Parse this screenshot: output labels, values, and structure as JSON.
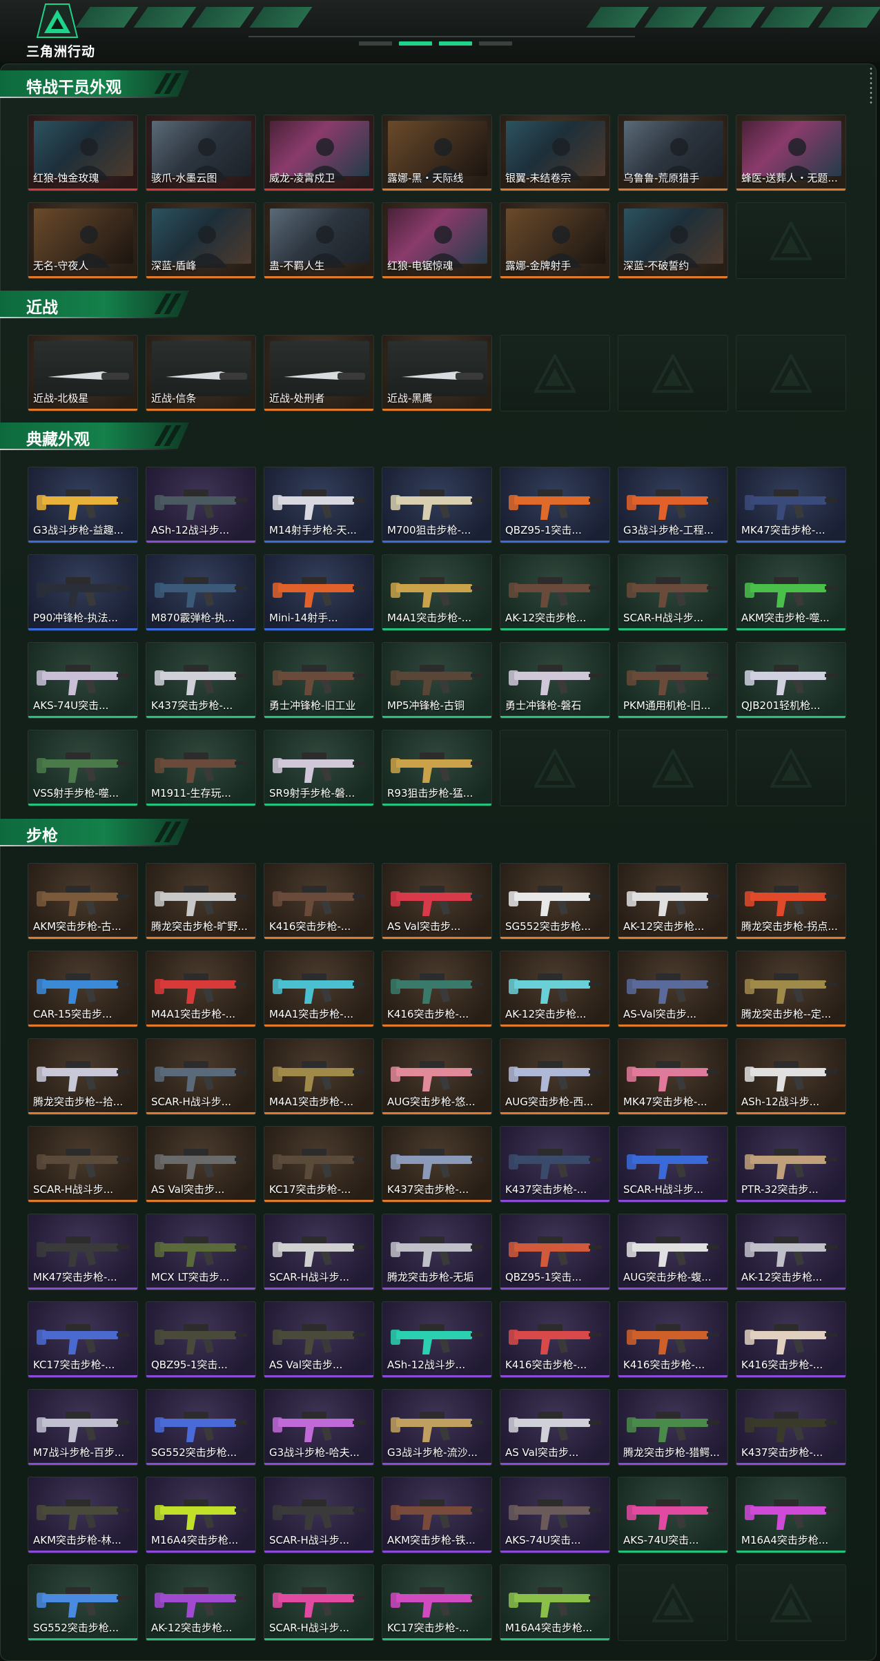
{
  "app": {
    "title": "三角洲行动"
  },
  "colors": {
    "accent": "#1ed48a",
    "section": "#14804a"
  },
  "sections": [
    {
      "title": "特战干员外观",
      "items": [
        {
          "label": "红狼-蚀金玫瑰",
          "tier": "red",
          "kind": "operator"
        },
        {
          "label": "骇爪-水墨云图",
          "tier": "red",
          "kind": "operator"
        },
        {
          "label": "威龙-凌霄戍卫",
          "tier": "red",
          "kind": "operator"
        },
        {
          "label": "露娜-黑・天际线",
          "tier": "orange",
          "kind": "operator"
        },
        {
          "label": "银翼-未结卷宗",
          "tier": "orange",
          "kind": "operator"
        },
        {
          "label": "乌鲁鲁-荒原猎手",
          "tier": "orange",
          "kind": "operator"
        },
        {
          "label": "蜂医-送葬人・无题...",
          "tier": "orange",
          "kind": "operator"
        },
        {
          "label": "无名-守夜人",
          "tier": "orange",
          "kind": "operator"
        },
        {
          "label": "深蓝-盾峰",
          "tier": "orange",
          "kind": "operator"
        },
        {
          "label": "蛊-不羁人生",
          "tier": "orange",
          "kind": "operator"
        },
        {
          "label": "红狼-电锯惊魂",
          "tier": "orange",
          "kind": "operator"
        },
        {
          "label": "露娜-金牌射手",
          "tier": "orange",
          "kind": "operator"
        },
        {
          "label": "深蓝-不破誓约",
          "tier": "orange",
          "kind": "operator"
        },
        {
          "label": "",
          "tier": "empty",
          "kind": "empty"
        }
      ]
    },
    {
      "title": "近战",
      "items": [
        {
          "label": "近战-北极星",
          "tier": "orange",
          "kind": "knife"
        },
        {
          "label": "近战-信条",
          "tier": "orange",
          "kind": "knife"
        },
        {
          "label": "近战-处刑者",
          "tier": "orange",
          "kind": "knife"
        },
        {
          "label": "近战-黑鹰",
          "tier": "orange",
          "kind": "knife"
        },
        {
          "label": "",
          "tier": "empty",
          "kind": "empty"
        },
        {
          "label": "",
          "tier": "empty",
          "kind": "empty"
        },
        {
          "label": "",
          "tier": "empty",
          "kind": "empty"
        }
      ]
    },
    {
      "title": "典藏外观",
      "items": [
        {
          "label": "G3战斗步枪-益趣...",
          "tier": "blue",
          "kind": "gun",
          "color": "#e8b23a"
        },
        {
          "label": "ASh-12战斗步...",
          "tier": "purple",
          "kind": "gun",
          "color": "#4a5a60"
        },
        {
          "label": "M14射手步枪-天...",
          "tier": "blue",
          "kind": "gun",
          "color": "#d8d8e0"
        },
        {
          "label": "M700狙击步枪-...",
          "tier": "blue",
          "kind": "gun",
          "color": "#d8cfb0"
        },
        {
          "label": "QBZ95-1突击...",
          "tier": "blue",
          "kind": "gun",
          "color": "#e06a2a"
        },
        {
          "label": "G3战斗步枪-工程...",
          "tier": "blue",
          "kind": "gun",
          "color": "#e0622a"
        },
        {
          "label": "MK47突击步枪-...",
          "tier": "blue",
          "kind": "gun",
          "color": "#3a4a7a"
        },
        {
          "label": "P90冲锋枪-执法...",
          "tier": "blue",
          "kind": "gun",
          "color": "#2a2e38"
        },
        {
          "label": "M870霰弹枪-执...",
          "tier": "blue",
          "kind": "gun",
          "color": "#3b5a7a"
        },
        {
          "label": "Mini-14射手...",
          "tier": "blue",
          "kind": "gun",
          "color": "#e0622a"
        },
        {
          "label": "M4A1突击步枪-...",
          "tier": "green",
          "kind": "gun",
          "color": "#c9a24a"
        },
        {
          "label": "AK-12突击步枪...",
          "tier": "green",
          "kind": "gun",
          "color": "#6a4a3a"
        },
        {
          "label": "SCAR-H战斗步...",
          "tier": "green",
          "kind": "gun",
          "color": "#6a4a3a"
        },
        {
          "label": "AKM突击步枪-噬...",
          "tier": "green",
          "kind": "gun",
          "color": "#4ac04a"
        },
        {
          "label": "AKS-74U突击...",
          "tier": "green",
          "kind": "gun",
          "color": "#c9c0d8"
        },
        {
          "label": "K437突击步枪-...",
          "tier": "green",
          "kind": "gun",
          "color": "#d0d0d8"
        },
        {
          "label": "勇士冲锋枪-旧工业",
          "tier": "green",
          "kind": "gun",
          "color": "#6a4a3a"
        },
        {
          "label": "MP5冲锋枪-古铜",
          "tier": "green",
          "kind": "gun",
          "color": "#5a4636"
        },
        {
          "label": "勇士冲锋枪-磐石",
          "tier": "green",
          "kind": "gun",
          "color": "#d0c8d8"
        },
        {
          "label": "PKM通用机枪-旧...",
          "tier": "green",
          "kind": "gun",
          "color": "#6a4a3a"
        },
        {
          "label": "QJB201轻机枪...",
          "tier": "green",
          "kind": "gun",
          "color": "#d0d0e0"
        },
        {
          "label": "VSS射手步枪-噬...",
          "tier": "green",
          "kind": "gun",
          "color": "#4a7a4a"
        },
        {
          "label": "M1911-生存玩...",
          "tier": "green",
          "kind": "gun",
          "color": "#6a4a3a"
        },
        {
          "label": "SR9射手步枪-磐...",
          "tier": "green",
          "kind": "gun",
          "color": "#d0c8d8"
        },
        {
          "label": "R93狙击步枪-猛...",
          "tier": "green",
          "kind": "gun",
          "color": "#c9a24a"
        },
        {
          "label": "",
          "tier": "empty",
          "kind": "empty"
        },
        {
          "label": "",
          "tier": "empty",
          "kind": "empty"
        },
        {
          "label": "",
          "tier": "empty",
          "kind": "empty"
        }
      ]
    },
    {
      "title": "步枪",
      "items": [
        {
          "label": "AKM突击步枪-古...",
          "tier": "orange",
          "kind": "gun",
          "color": "#7a5a3a"
        },
        {
          "label": "腾龙突击步枪-旷野...",
          "tier": "orange",
          "kind": "gun",
          "color": "#c8c8c8"
        },
        {
          "label": "K416突击步枪-...",
          "tier": "orange",
          "kind": "gun",
          "color": "#6a4a3a"
        },
        {
          "label": "AS Val突击步...",
          "tier": "orange",
          "kind": "gun",
          "color": "#d83a4a"
        },
        {
          "label": "SG552突击步枪...",
          "tier": "orange",
          "kind": "gun",
          "color": "#e8e8e8"
        },
        {
          "label": "AK-12突击步枪...",
          "tier": "orange",
          "kind": "gun",
          "color": "#e0e0e0"
        },
        {
          "label": "腾龙突击步枪-拐点...",
          "tier": "orange",
          "kind": "gun",
          "color": "#e04a2a"
        },
        {
          "label": "CAR-15突击步...",
          "tier": "orange",
          "kind": "gun",
          "color": "#3a8ad8"
        },
        {
          "label": "M4A1突击步枪-...",
          "tier": "orange",
          "kind": "gun",
          "color": "#d83a3a"
        },
        {
          "label": "M4A1突击步枪-...",
          "tier": "orange",
          "kind": "gun",
          "color": "#4ac0d0"
        },
        {
          "label": "K416突击步枪-...",
          "tier": "orange",
          "kind": "gun",
          "color": "#3a7a6a"
        },
        {
          "label": "AK-12突击步枪...",
          "tier": "orange",
          "kind": "gun",
          "color": "#6ad0d8"
        },
        {
          "label": "AS-Val突击步...",
          "tier": "orange",
          "kind": "gun",
          "color": "#5a6a9a"
        },
        {
          "label": "腾龙突击步枪--定...",
          "tier": "orange",
          "kind": "gun",
          "color": "#a08a4a"
        },
        {
          "label": "腾龙突击步枪--拾...",
          "tier": "orange",
          "kind": "gun",
          "color": "#c8c8d8"
        },
        {
          "label": "SCAR-H战斗步...",
          "tier": "orange",
          "kind": "gun",
          "color": "#5a6a7a"
        },
        {
          "label": "M4A1突击步枪-...",
          "tier": "orange",
          "kind": "gun",
          "color": "#a08a4a"
        },
        {
          "label": "AUG突击步枪-悠...",
          "tier": "orange",
          "kind": "gun",
          "color": "#e08a9a"
        },
        {
          "label": "AUG突击步枪-西...",
          "tier": "orange",
          "kind": "gun",
          "color": "#b0b8d8"
        },
        {
          "label": "MK47突击步枪-...",
          "tier": "orange",
          "kind": "gun",
          "color": "#e07a9a"
        },
        {
          "label": "ASh-12战斗步...",
          "tier": "orange",
          "kind": "gun",
          "color": "#e0e0e0"
        },
        {
          "label": "SCAR-H战斗步...",
          "tier": "orange",
          "kind": "gun",
          "color": "#5a4a3a"
        },
        {
          "label": "AS Val突击步...",
          "tier": "orange",
          "kind": "gun",
          "color": "#6a6a6a"
        },
        {
          "label": "KC17突击步枪-...",
          "tier": "orange",
          "kind": "gun",
          "color": "#5a4a3a"
        },
        {
          "label": "K437突击步枪-...",
          "tier": "orange",
          "kind": "gun",
          "color": "#8a9ab8"
        },
        {
          "label": "K437突击步枪-...",
          "tier": "purple",
          "kind": "gun",
          "color": "#3a4a6a"
        },
        {
          "label": "SCAR-H战斗步...",
          "tier": "purple",
          "kind": "gun",
          "color": "#3a6ad8"
        },
        {
          "label": "PTR-32突击步...",
          "tier": "purple",
          "kind": "gun",
          "color": "#c0a07a"
        },
        {
          "label": "MK47突击步枪-...",
          "tier": "purple",
          "kind": "gun",
          "color": "#3a3a3a"
        },
        {
          "label": "MCX LT突击步...",
          "tier": "purple",
          "kind": "gun",
          "color": "#5a6a3a"
        },
        {
          "label": "SCAR-H战斗步...",
          "tier": "purple",
          "kind": "gun",
          "color": "#d0d0d0"
        },
        {
          "label": "腾龙突击步枪-无垢",
          "tier": "purple",
          "kind": "gun",
          "color": "#c0c0c8"
        },
        {
          "label": "QBZ95-1突击...",
          "tier": "purple",
          "kind": "gun",
          "color": "#d05a3a"
        },
        {
          "label": "AUG突击步枪-蝮...",
          "tier": "purple",
          "kind": "gun",
          "color": "#e0e0e0"
        },
        {
          "label": "AK-12突击步枪...",
          "tier": "purple",
          "kind": "gun",
          "color": "#c0c0c8"
        },
        {
          "label": "KC17突击步枪-...",
          "tier": "purple",
          "kind": "gun",
          "color": "#4a6ad0"
        },
        {
          "label": "QBZ95-1突击...",
          "tier": "purple",
          "kind": "gun",
          "color": "#4a4a3a"
        },
        {
          "label": "AS Val突击步...",
          "tier": "purple",
          "kind": "gun",
          "color": "#4a4a3a"
        },
        {
          "label": "ASh-12战斗步...",
          "tier": "purple",
          "kind": "gun",
          "color": "#2ad0b0"
        },
        {
          "label": "K416突击步枪-...",
          "tier": "purple",
          "kind": "gun",
          "color": "#d84a4a"
        },
        {
          "label": "K416突击步枪-...",
          "tier": "purple",
          "kind": "gun",
          "color": "#d0602a"
        },
        {
          "label": "K416突击步枪-...",
          "tier": "purple",
          "kind": "gun",
          "color": "#e0d0c0"
        },
        {
          "label": "M7战斗步枪-百步...",
          "tier": "purple",
          "kind": "gun",
          "color": "#c0c0d0"
        },
        {
          "label": "SG552突击步枪...",
          "tier": "purple",
          "kind": "gun",
          "color": "#4a6ad8"
        },
        {
          "label": "G3战斗步枪-哈夫...",
          "tier": "purple",
          "kind": "gun",
          "color": "#c06ad8"
        },
        {
          "label": "G3战斗步枪-流沙...",
          "tier": "purple",
          "kind": "gun",
          "color": "#c0a060"
        },
        {
          "label": "AS Val突击步...",
          "tier": "purple",
          "kind": "gun",
          "color": "#d0d0d8"
        },
        {
          "label": "腾龙突击步枪-猎鳄...",
          "tier": "purple",
          "kind": "gun",
          "color": "#4a8a4a"
        },
        {
          "label": "K437突击步枪-...",
          "tier": "purple",
          "kind": "gun",
          "color": "#3a3a2a"
        },
        {
          "label": "AKM突击步枪-林...",
          "tier": "purple",
          "kind": "gun",
          "color": "#4a4a3a"
        },
        {
          "label": "M16A4突击步枪...",
          "tier": "purple",
          "kind": "gun",
          "color": "#c0e02a"
        },
        {
          "label": "SCAR-H战斗步...",
          "tier": "purple",
          "kind": "gun",
          "color": "#3a3a3a"
        },
        {
          "label": "AKM突击步枪-铁...",
          "tier": "purple",
          "kind": "gun",
          "color": "#7a4a3a"
        },
        {
          "label": "AKS-74U突击...",
          "tier": "purple",
          "kind": "gun",
          "color": "#6a5a5a"
        },
        {
          "label": "AKS-74U突击...",
          "tier": "green",
          "kind": "gun",
          "color": "#e04aa0"
        },
        {
          "label": "M16A4突击步枪...",
          "tier": "green",
          "kind": "gun",
          "color": "#d04ad8"
        },
        {
          "label": "SG552突击步枪...",
          "tier": "green",
          "kind": "gun",
          "color": "#4a8ae0"
        },
        {
          "label": "AK-12突击步枪...",
          "tier": "green",
          "kind": "gun",
          "color": "#a04ad0"
        },
        {
          "label": "SCAR-H战斗步...",
          "tier": "green",
          "kind": "gun",
          "color": "#e04aa0"
        },
        {
          "label": "KC17突击步枪-...",
          "tier": "green",
          "kind": "gun",
          "color": "#d04ac0"
        },
        {
          "label": "M16A4突击步枪...",
          "tier": "green",
          "kind": "gun",
          "color": "#8ac04a"
        },
        {
          "label": "",
          "tier": "empty",
          "kind": "empty"
        },
        {
          "label": "",
          "tier": "empty",
          "kind": "empty"
        }
      ]
    }
  ]
}
